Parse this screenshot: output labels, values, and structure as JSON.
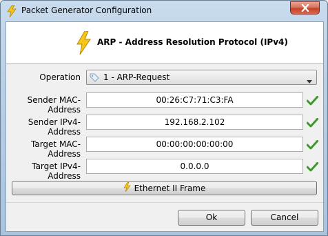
{
  "window": {
    "title": "Packet Generator Configuration"
  },
  "header": {
    "title": "ARP - Address Resolution Protocol (IPv4)"
  },
  "form": {
    "operation": {
      "label": "Operation",
      "value": "1 - ARP-Request"
    },
    "sender_mac": {
      "label": "Sender MAC-Address",
      "value": "00:26:C7:71:C3:FA",
      "valid": true
    },
    "sender_ip": {
      "label": "Sender IPv4-Address",
      "value": "192.168.2.102",
      "valid": true
    },
    "target_mac": {
      "label": "Target MAC-Address",
      "value": "00:00:00:00:00:00",
      "valid": true
    },
    "target_ip": {
      "label": "Target IPv4-Address",
      "value": "0.0.0.0",
      "valid": true
    }
  },
  "frame_button": {
    "label": "Ethernet II Frame",
    "icon": "lightning-icon"
  },
  "footer": {
    "ok_label": "Ok",
    "cancel_label": "Cancel"
  },
  "colors": {
    "accent_yellow": "#f5c518",
    "check_green": "#3a9a2a",
    "close_red": "#c4432a"
  }
}
